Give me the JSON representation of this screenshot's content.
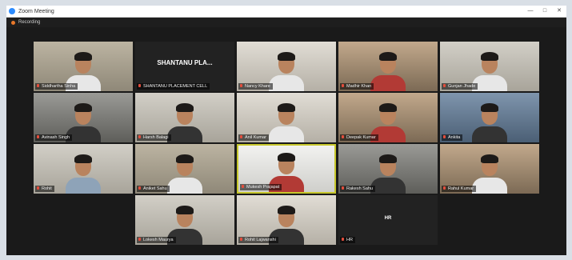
{
  "window": {
    "title": "Zoom Meeting",
    "controls": [
      "—",
      "□",
      "✕"
    ]
  },
  "recording": {
    "label": "Recording",
    "dot_color": "#e8782a"
  },
  "rows": [
    [
      {
        "name": "Siddhartha Sinha",
        "bg": "bg-light1",
        "torso": "",
        "active": false,
        "video": true
      },
      {
        "name": "SHANTANU PLACEMENT CELL",
        "display": "SHANTANU PLA...",
        "video": false
      },
      {
        "name": "Nancy Khare",
        "bg": "bg-light3",
        "torso": "",
        "active": false,
        "video": true
      },
      {
        "name": "Madhir Khan",
        "bg": "bg-warm",
        "torso": "red",
        "active": false,
        "video": true
      },
      {
        "name": "Gunjan Jhade",
        "bg": "bg-light2",
        "torso": "",
        "active": false,
        "video": true
      }
    ],
    [
      {
        "name": "Avinash Singh",
        "bg": "bg-grey",
        "torso": "dark",
        "active": false,
        "video": true
      },
      {
        "name": "Harsh Balagi",
        "bg": "bg-light2",
        "torso": "dark",
        "active": false,
        "video": true
      },
      {
        "name": "Anil Kumar",
        "bg": "bg-light3",
        "torso": "",
        "active": false,
        "video": true
      },
      {
        "name": "Deepak Kumar",
        "bg": "bg-warm",
        "torso": "red",
        "active": false,
        "video": true
      },
      {
        "name": "Ankita",
        "bg": "bg-blue",
        "torso": "dark",
        "active": false,
        "video": true
      }
    ],
    [
      {
        "name": "Rohit",
        "bg": "bg-light2",
        "torso": "blue",
        "active": false,
        "video": true
      },
      {
        "name": "Aniket Sahu",
        "bg": "bg-light1",
        "torso": "",
        "active": false,
        "video": true
      },
      {
        "name": "Mukesh Prajapat",
        "bg": "bg-white",
        "torso": "red",
        "active": true,
        "video": true
      },
      {
        "name": "Rakesh Sahu",
        "bg": "bg-grey",
        "torso": "dark",
        "active": false,
        "video": true
      },
      {
        "name": "Rahul Kumar",
        "bg": "bg-warm",
        "torso": "",
        "active": false,
        "video": true
      }
    ],
    [
      {
        "name": "Lokesh Maurya",
        "bg": "bg-light2",
        "torso": "dark",
        "active": false,
        "video": true
      },
      {
        "name": "Rohit Lajwanshi",
        "bg": "bg-light3",
        "torso": "dark",
        "active": false,
        "video": true
      },
      {
        "name": "HR",
        "display": "HR",
        "video": false
      }
    ]
  ]
}
